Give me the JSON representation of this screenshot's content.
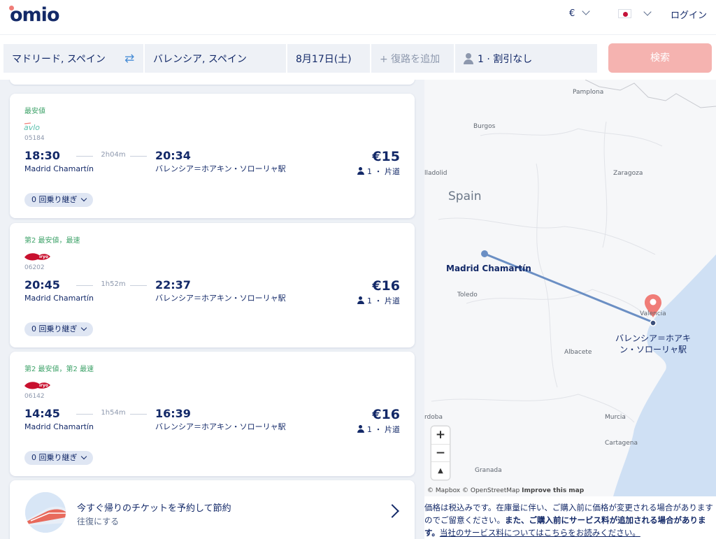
{
  "header": {
    "logo": "omio",
    "currency": "€",
    "login": "ログイン"
  },
  "search": {
    "origin": "マドリード, スペイン",
    "destination": "バレンシア, スペイン",
    "date": "8月17日(土)",
    "return_placeholder": "+ 復路を追加",
    "passengers": "1 · 割引なし",
    "search_button": "検索"
  },
  "results": [
    {
      "tag": "最安値",
      "operator": "avlo",
      "train_no": "05184",
      "dep_time": "18:30",
      "duration": "2h04m",
      "arr_time": "20:34",
      "from": "Madrid Chamartín",
      "to": "バレンシア＝ホアキン・ソローリャ駅",
      "price": "€15",
      "pax": "1 ・ 片道",
      "transfers": "0 回乗り継ぎ"
    },
    {
      "tag": "第2 最安値，最速",
      "operator": "iryo",
      "train_no": "06202",
      "dep_time": "20:45",
      "duration": "1h52m",
      "arr_time": "22:37",
      "from": "Madrid Chamartín",
      "to": "バレンシア＝ホアキン・ソローリャ駅",
      "price": "€16",
      "pax": "1 ・ 片道",
      "transfers": "0 回乗り継ぎ"
    },
    {
      "tag": "第2 最安値，第2 最速",
      "operator": "iryo",
      "train_no": "06142",
      "dep_time": "14:45",
      "duration": "1h54m",
      "arr_time": "16:39",
      "from": "Madrid Chamartín",
      "to": "バレンシア＝ホアキン・ソローリャ駅",
      "price": "€16",
      "pax": "1 ・ 片道",
      "transfers": "0 回乗り継ぎ"
    }
  ],
  "return_promo": {
    "title": "今すぐ帰りのチケットを予約して節約",
    "subtitle": "往復にする"
  },
  "map": {
    "country": "Spain",
    "cities": [
      "Pamplona",
      "Burgos",
      "lladolid",
      "Zaragoza",
      "Toledo",
      "Valencia",
      "Albacete",
      "rdoba",
      "Murcia",
      "Cartagena",
      "Granada"
    ],
    "origin_label": "Madrid Chamartín",
    "destination_label": "バレンシア＝ホアキン・ソローリャ駅",
    "zoom_in": "+",
    "zoom_out": "−",
    "compass": "▲",
    "attribution_mapbox": "© Mapbox",
    "attribution_osm": "© OpenStreetMap",
    "attribution_improve": "Improve this map",
    "colors": {
      "route": "#6b8fc4",
      "pin": "#f07d78",
      "sea": "#cfe0f4"
    }
  },
  "disclaimer": {
    "normal": "価格は税込みです。在庫量に伴い、ご購入前に価格が変更される場合がありますのでご留意ください。",
    "bold": "また、ご購入前にサービス料が追加される場合があります。",
    "link": "当社のサービス料についてはこちらをお読みください。"
  },
  "colors": {
    "brand_navy": "#132968",
    "brand_coral": "#f07d78",
    "tag_green": "#3fa36a"
  }
}
